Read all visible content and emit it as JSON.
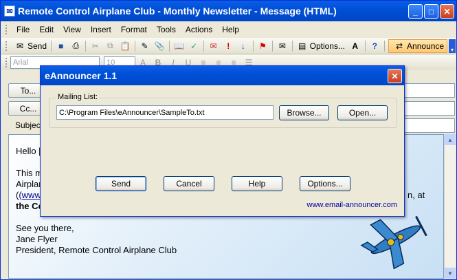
{
  "window": {
    "title": "Remote Control Airplane Club - Monthly Newsletter - Message (HTML)",
    "btn_min": "_",
    "btn_max": "□",
    "btn_close": "✕"
  },
  "menu": [
    "File",
    "Edit",
    "View",
    "Insert",
    "Format",
    "Tools",
    "Actions",
    "Help"
  ],
  "toolbar": {
    "send": "Send",
    "options": "Options...",
    "announce": "Announce"
  },
  "format": {
    "font": "Arial",
    "size": "10"
  },
  "headers": {
    "to_label": "To...",
    "cc_label": "Cc...",
    "subject_label": "Subject:"
  },
  "body": {
    "greeting": "Hello [",
    "line1": "This m",
    "line2": "Airplan",
    "line3a": "(www.",
    "line3b": "n, at",
    "line4": "the Co",
    "signoff": "See you there,",
    "name": "Jane Flyer",
    "role": "President, Remote Control Airplane Club"
  },
  "dialog": {
    "title": "eAnnouncer 1.1",
    "group_label": "Mailing List:",
    "path_value": "C:\\Program Files\\eAnnouncer\\SampleTo.txt",
    "browse": "Browse...",
    "open": "Open...",
    "send": "Send",
    "cancel": "Cancel",
    "help": "Help",
    "options": "Options...",
    "website": "www.email-announcer.com"
  }
}
